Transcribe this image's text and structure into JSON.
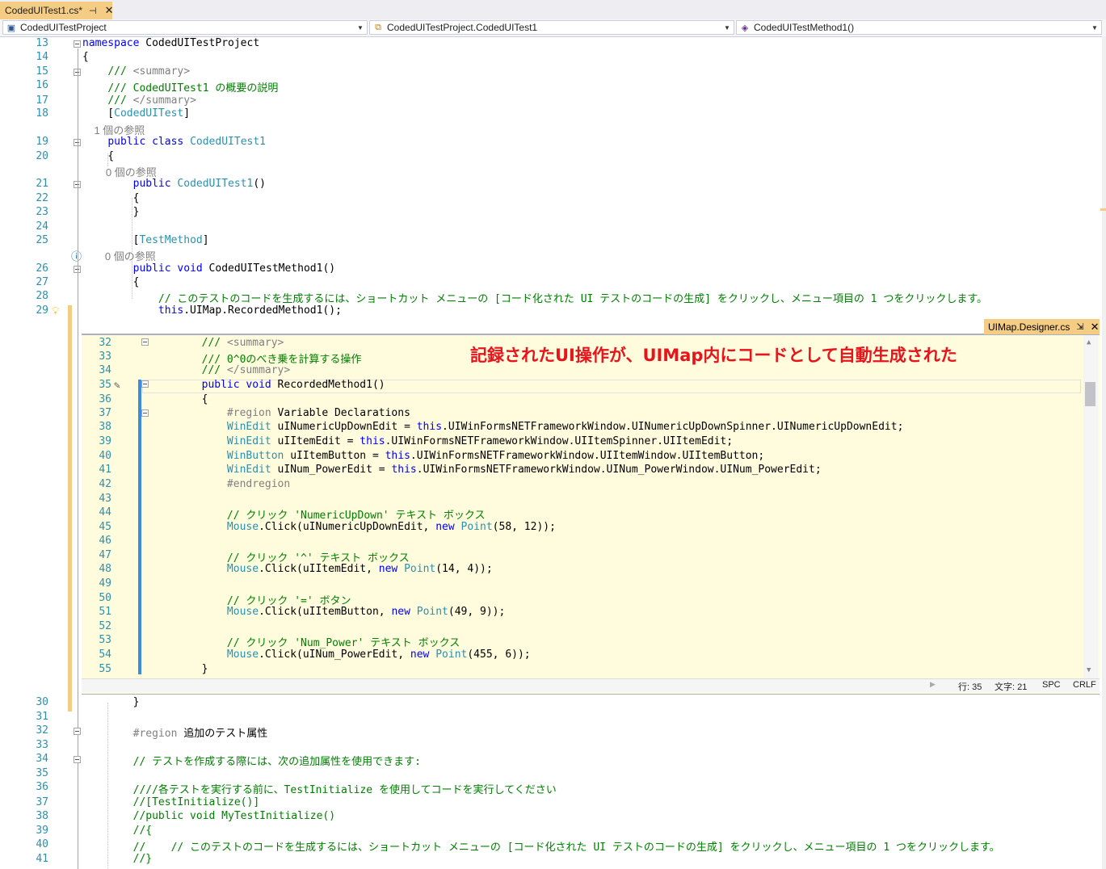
{
  "tab": {
    "title": "CodedUITest1.cs*",
    "pin_icon": "pin-icon",
    "close_icon": "close-icon",
    "accent": "#f5cc84"
  },
  "navbar": {
    "project": "CodedUITestProject",
    "class": "CodedUITestProject.CodedUITest1",
    "member": "CodedUITestMethod1()"
  },
  "editor_lines_top": [
    {
      "n": "13",
      "t": "namespace CodedUITestProject"
    },
    {
      "n": "14",
      "t": "{"
    },
    {
      "n": "15",
      "t": "    /// <summary>"
    },
    {
      "n": "16",
      "t": "    /// CodedUITest1 の概要の説明"
    },
    {
      "n": "17",
      "t": "    /// </summary>"
    },
    {
      "n": "18",
      "t": "    [CodedUITest]"
    },
    {
      "n": "",
      "t": "    1 個の参照"
    },
    {
      "n": "19",
      "t": "    public class CodedUITest1"
    },
    {
      "n": "20",
      "t": "    {"
    },
    {
      "n": "",
      "t": "        0 個の参照"
    },
    {
      "n": "21",
      "t": "        public CodedUITest1()"
    },
    {
      "n": "22",
      "t": "        {"
    },
    {
      "n": "23",
      "t": "        }"
    },
    {
      "n": "24",
      "t": ""
    },
    {
      "n": "25",
      "t": "        [TestMethod]"
    },
    {
      "n": "",
      "t": "        |0 個の参照"
    },
    {
      "n": "26",
      "t": "        public void CodedUITestMethod1()"
    },
    {
      "n": "27",
      "t": "        {"
    },
    {
      "n": "28",
      "t": "            // このテストのコードを生成するには、ショートカット メニューの [コード化された UI テストのコードの生成] をクリックし、メニュー項目の 1 つをクリックします。"
    },
    {
      "n": "29",
      "t": "            this.UIMap.RecordedMethod1();"
    }
  ],
  "peek": {
    "tab_title": "UIMap.Designer.cs",
    "annotation": "記録されたUI操作が、UIMap内にコードとして自動生成された",
    "lines": [
      {
        "n": "32",
        "t": "        /// <summary>"
      },
      {
        "n": "33",
        "t": "        /// 0^0のべき乗を計算する操作"
      },
      {
        "n": "34",
        "t": "        /// </summary>"
      },
      {
        "n": "35",
        "t": "        public void RecordedMethod1()"
      },
      {
        "n": "36",
        "t": "        {"
      },
      {
        "n": "37",
        "t": "            #region Variable Declarations"
      },
      {
        "n": "38",
        "t": "            WinEdit uINumericUpDownEdit = this.UIWinFormsNETFrameworkWindow.UINumericUpDownSpinner.UINumericUpDownEdit;"
      },
      {
        "n": "39",
        "t": "            WinEdit uIItemEdit = this.UIWinFormsNETFrameworkWindow.UIItemSpinner.UIItemEdit;"
      },
      {
        "n": "40",
        "t": "            WinButton uIItemButton = this.UIWinFormsNETFrameworkWindow.UIItemWindow.UIItemButton;"
      },
      {
        "n": "41",
        "t": "            WinEdit uINum_PowerEdit = this.UIWinFormsNETFrameworkWindow.UINum_PowerWindow.UINum_PowerEdit;"
      },
      {
        "n": "42",
        "t": "            #endregion"
      },
      {
        "n": "43",
        "t": ""
      },
      {
        "n": "44",
        "t": "            // クリック 'NumericUpDown' テキスト ボックス"
      },
      {
        "n": "45",
        "t": "            Mouse.Click(uINumericUpDownEdit, new Point(58, 12));"
      },
      {
        "n": "46",
        "t": ""
      },
      {
        "n": "47",
        "t": "            // クリック '^' テキスト ボックス"
      },
      {
        "n": "48",
        "t": "            Mouse.Click(uIItemEdit, new Point(14, 4));"
      },
      {
        "n": "49",
        "t": ""
      },
      {
        "n": "50",
        "t": "            // クリック '=' ボタン"
      },
      {
        "n": "51",
        "t": "            Mouse.Click(uIItemButton, new Point(49, 9));"
      },
      {
        "n": "52",
        "t": ""
      },
      {
        "n": "53",
        "t": "            // クリック 'Num_Power' テキスト ボックス"
      },
      {
        "n": "54",
        "t": "            Mouse.Click(uINum_PowerEdit, new Point(455, 6));"
      },
      {
        "n": "55",
        "t": "        }"
      }
    ],
    "status": {
      "line": "行: 35",
      "char": "文字: 21",
      "ws": "SPC",
      "eol": "CRLF"
    }
  },
  "editor_lines_bottom": [
    {
      "n": "30",
      "t": "        }"
    },
    {
      "n": "31",
      "t": ""
    },
    {
      "n": "32",
      "t": "        #region 追加のテスト属性"
    },
    {
      "n": "33",
      "t": ""
    },
    {
      "n": "34",
      "t": "        // テストを作成する際には、次の追加属性を使用できます:"
    },
    {
      "n": "35",
      "t": ""
    },
    {
      "n": "36",
      "t": "        ////各テストを実行する前に、TestInitialize を使用してコードを実行してください"
    },
    {
      "n": "37",
      "t": "        //[TestInitialize()]"
    },
    {
      "n": "38",
      "t": "        //public void MyTestInitialize()"
    },
    {
      "n": "39",
      "t": "        //{"
    },
    {
      "n": "40",
      "t": "        //    // このテストのコードを生成するには、ショートカット メニューの [コード化された UI テストのコードの生成] をクリックし、メニュー項目の 1 つをクリックします。"
    },
    {
      "n": "41",
      "t": "        //}"
    }
  ],
  "colors": {
    "keyword": "#0000ff",
    "type": "#2b91af",
    "comment": "#008000",
    "line_number": "#2b91af",
    "peek_bg": "#fffbdd",
    "annotation": "#e8141b"
  }
}
